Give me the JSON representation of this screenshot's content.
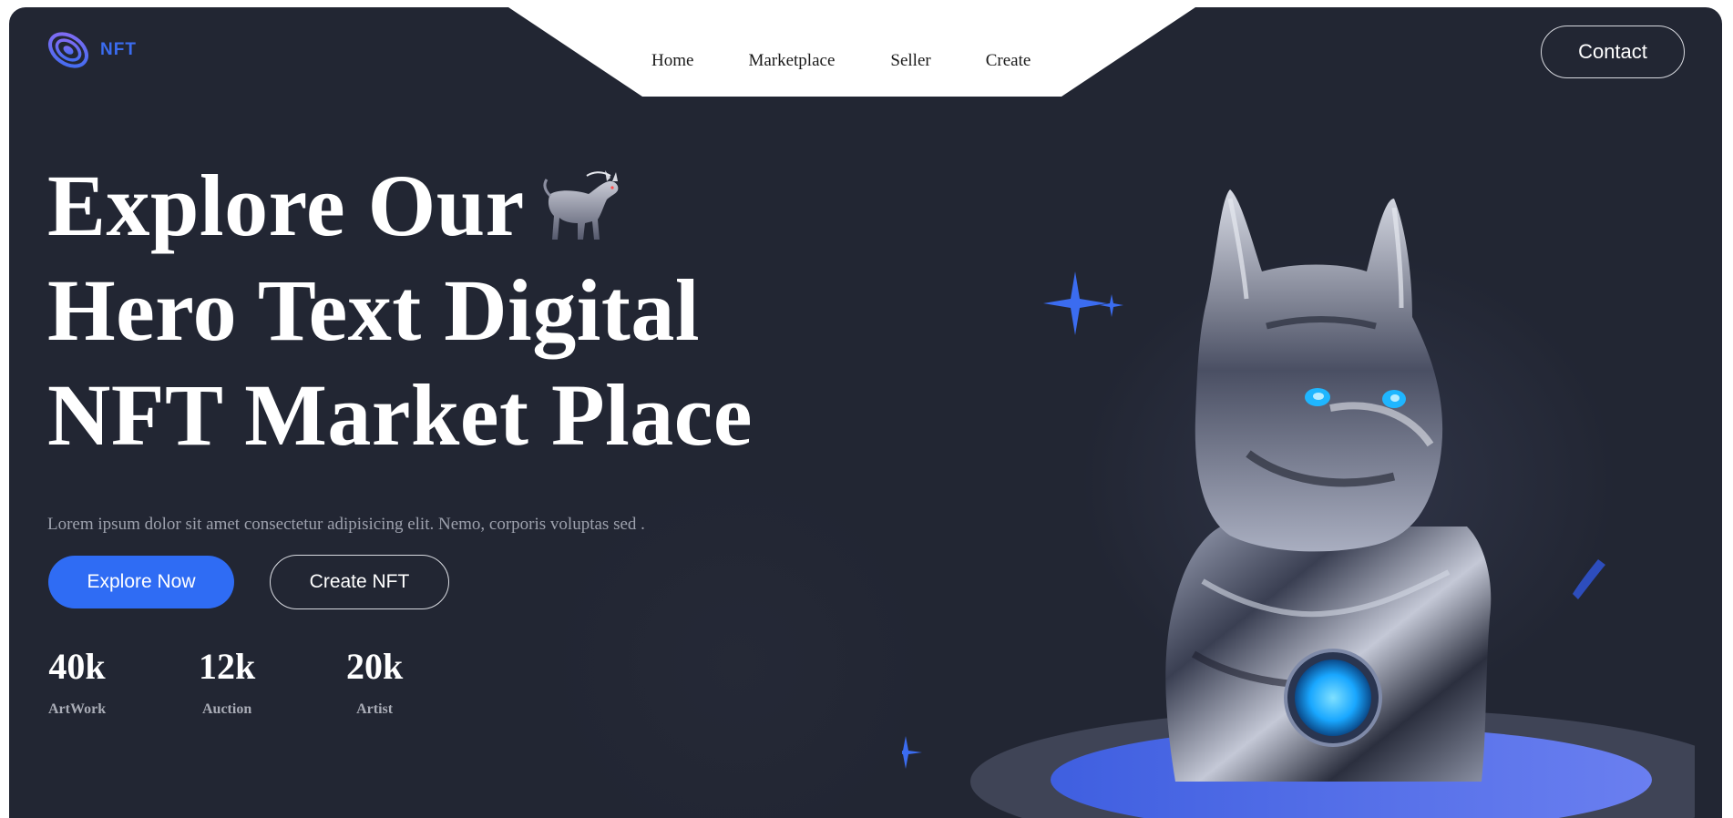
{
  "brand": {
    "logo_text": "NFT",
    "logo_icon": "swirl-logo-icon",
    "accent": "#3b6cf0"
  },
  "nav": {
    "items": [
      "Home",
      "Marketplace",
      "Seller",
      "Create"
    ]
  },
  "header": {
    "contact_label": "Contact"
  },
  "hero": {
    "title_lines": [
      "Explore Our",
      "Hero Text Digital",
      "NFT Market Place"
    ],
    "title_icon": "robot-wolf-icon",
    "description": "Lorem ipsum dolor sit amet consectetur adipisicing elit. Nemo, corporis voluptas sed .",
    "primary_button": "Explore Now",
    "secondary_button": "Create NFT",
    "primary_color": "#2f6cf4"
  },
  "stats": [
    {
      "value": "40k",
      "label": "ArtWork"
    },
    {
      "value": "12k",
      "label": "Auction"
    },
    {
      "value": "20k",
      "label": "Artist"
    }
  ],
  "illustration": {
    "name": "chrome-dog-statue-image",
    "glow_color": "#1fb6ff",
    "platform_color": "#4d6ee8"
  },
  "colors": {
    "background": "#222633",
    "text": "#ffffff",
    "muted": "#9da1ad"
  }
}
